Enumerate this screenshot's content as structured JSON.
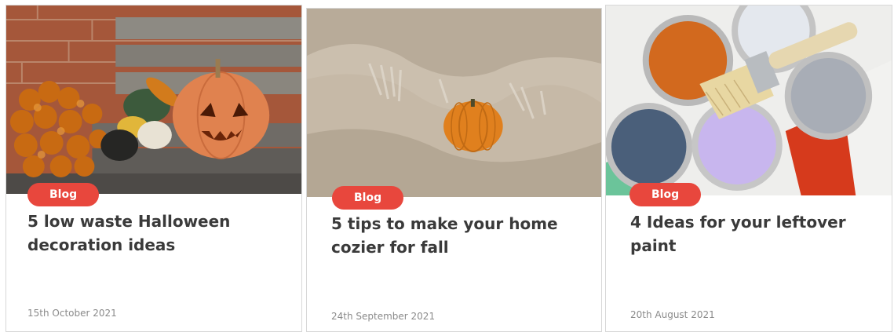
{
  "cards": [
    {
      "badge": "Blog",
      "title": "5 low waste Halloween decoration ideas",
      "date": "15th October 2021"
    },
    {
      "badge": "Blog",
      "title": "5 tips to make your home cozier for fall",
      "date": "24th September 2021"
    },
    {
      "badge": "Blog",
      "title": "4 Ideas for your leftover paint",
      "date": "20th August 2021"
    }
  ],
  "colors": {
    "badge": "#e8473d",
    "title": "#3a3a3a",
    "date": "#8a8a8a",
    "card_border": "#d8d8d8"
  }
}
